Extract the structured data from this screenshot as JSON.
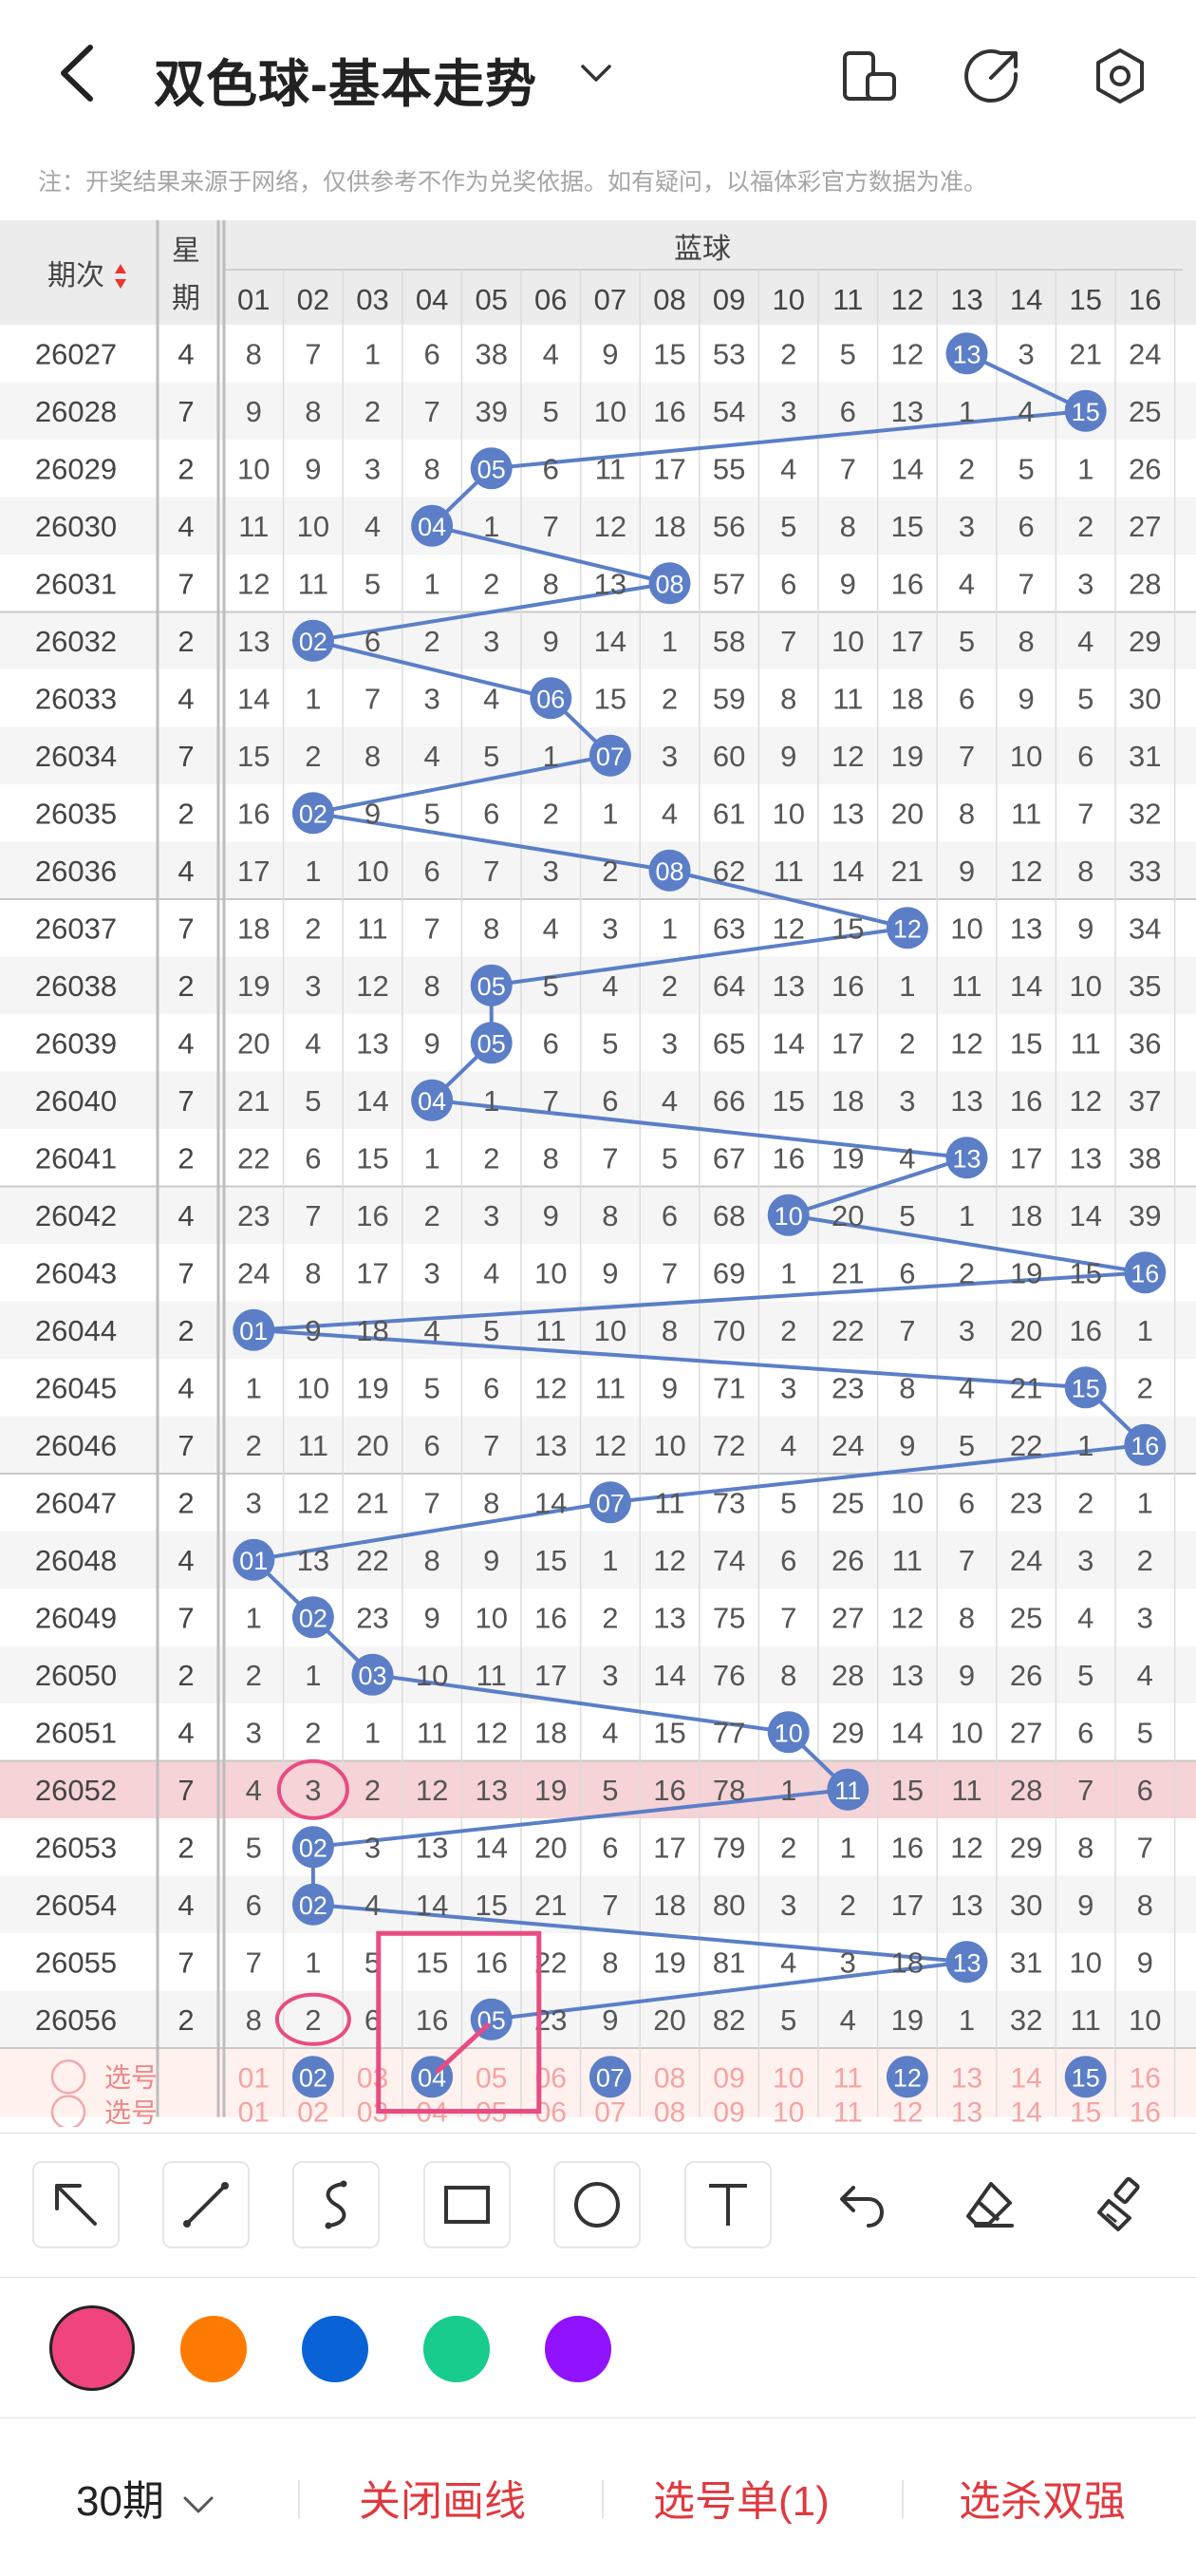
{
  "header": {
    "title": "双色球-基本走势",
    "icons": [
      "back-icon",
      "chevron-down-icon",
      "layout-icon",
      "share-icon",
      "settings-icon"
    ]
  },
  "notice": "注：开奖结果来源于网络，仅供参考不作为兑奖依据。如有疑问，以福体彩官方数据为准。",
  "table": {
    "col_period": "期次",
    "col_week_line1": "星",
    "col_week_line2": "期",
    "group_label": "蓝球",
    "col_numbers": [
      "01",
      "02",
      "03",
      "04",
      "05",
      "06",
      "07",
      "08",
      "09",
      "10",
      "11",
      "12",
      "13",
      "14",
      "15",
      "16"
    ],
    "rows": [
      {
        "period": "26027",
        "week": "4",
        "cells": [
          8,
          7,
          1,
          6,
          38,
          4,
          9,
          15,
          53,
          2,
          5,
          12,
          "13",
          3,
          21,
          24
        ]
      },
      {
        "period": "26028",
        "week": "7",
        "cells": [
          9,
          8,
          2,
          7,
          39,
          5,
          10,
          16,
          54,
          3,
          6,
          13,
          1,
          4,
          "15",
          25
        ]
      },
      {
        "period": "26029",
        "week": "2",
        "cells": [
          10,
          9,
          3,
          8,
          "05",
          6,
          11,
          17,
          55,
          4,
          7,
          14,
          2,
          5,
          1,
          26
        ]
      },
      {
        "period": "26030",
        "week": "4",
        "cells": [
          11,
          10,
          4,
          "04",
          1,
          7,
          12,
          18,
          56,
          5,
          8,
          15,
          3,
          6,
          2,
          27
        ]
      },
      {
        "period": "26031",
        "week": "7",
        "cells": [
          12,
          11,
          5,
          1,
          2,
          8,
          13,
          "08",
          57,
          6,
          9,
          16,
          4,
          7,
          3,
          28
        ]
      },
      {
        "period": "26032",
        "week": "2",
        "cells": [
          13,
          "02",
          6,
          2,
          3,
          9,
          14,
          1,
          58,
          7,
          10,
          17,
          5,
          8,
          4,
          29
        ]
      },
      {
        "period": "26033",
        "week": "4",
        "cells": [
          14,
          1,
          7,
          3,
          4,
          "06",
          15,
          2,
          59,
          8,
          11,
          18,
          6,
          9,
          5,
          30
        ]
      },
      {
        "period": "26034",
        "week": "7",
        "cells": [
          15,
          2,
          8,
          4,
          5,
          1,
          "07",
          3,
          60,
          9,
          12,
          19,
          7,
          10,
          6,
          31
        ]
      },
      {
        "period": "26035",
        "week": "2",
        "cells": [
          16,
          "02",
          9,
          5,
          6,
          2,
          1,
          4,
          61,
          10,
          13,
          20,
          8,
          11,
          7,
          32
        ]
      },
      {
        "period": "26036",
        "week": "4",
        "cells": [
          17,
          1,
          10,
          6,
          7,
          3,
          2,
          "08",
          62,
          11,
          14,
          21,
          9,
          12,
          8,
          33
        ]
      },
      {
        "period": "26037",
        "week": "7",
        "cells": [
          18,
          2,
          11,
          7,
          8,
          4,
          3,
          1,
          63,
          12,
          15,
          "12",
          10,
          13,
          9,
          34
        ]
      },
      {
        "period": "26038",
        "week": "2",
        "cells": [
          19,
          3,
          12,
          8,
          "05",
          5,
          4,
          2,
          64,
          13,
          16,
          1,
          11,
          14,
          10,
          35
        ]
      },
      {
        "period": "26039",
        "week": "4",
        "cells": [
          20,
          4,
          13,
          9,
          "05",
          6,
          5,
          3,
          65,
          14,
          17,
          2,
          12,
          15,
          11,
          36
        ]
      },
      {
        "period": "26040",
        "week": "7",
        "cells": [
          21,
          5,
          14,
          "04",
          1,
          7,
          6,
          4,
          66,
          15,
          18,
          3,
          13,
          16,
          12,
          37
        ]
      },
      {
        "period": "26041",
        "week": "2",
        "cells": [
          22,
          6,
          15,
          1,
          2,
          8,
          7,
          5,
          67,
          16,
          19,
          4,
          "13",
          17,
          13,
          38
        ]
      },
      {
        "period": "26042",
        "week": "4",
        "cells": [
          23,
          7,
          16,
          2,
          3,
          9,
          8,
          6,
          68,
          "10",
          20,
          5,
          1,
          18,
          14,
          39
        ]
      },
      {
        "period": "26043",
        "week": "7",
        "cells": [
          24,
          8,
          17,
          3,
          4,
          10,
          9,
          7,
          69,
          1,
          21,
          6,
          2,
          19,
          15,
          "16"
        ]
      },
      {
        "period": "26044",
        "week": "2",
        "cells": [
          "01",
          9,
          18,
          4,
          5,
          11,
          10,
          8,
          70,
          2,
          22,
          7,
          3,
          20,
          16,
          1
        ]
      },
      {
        "period": "26045",
        "week": "4",
        "cells": [
          1,
          10,
          19,
          5,
          6,
          12,
          11,
          9,
          71,
          3,
          23,
          8,
          4,
          21,
          "15",
          2
        ]
      },
      {
        "period": "26046",
        "week": "7",
        "cells": [
          2,
          11,
          20,
          6,
          7,
          13,
          12,
          10,
          72,
          4,
          24,
          9,
          5,
          22,
          1,
          "16"
        ]
      },
      {
        "period": "26047",
        "week": "2",
        "cells": [
          3,
          12,
          21,
          7,
          8,
          14,
          "07",
          11,
          73,
          5,
          25,
          10,
          6,
          23,
          2,
          1
        ]
      },
      {
        "period": "26048",
        "week": "4",
        "cells": [
          "01",
          13,
          22,
          8,
          9,
          15,
          1,
          12,
          74,
          6,
          26,
          11,
          7,
          24,
          3,
          2
        ]
      },
      {
        "period": "26049",
        "week": "7",
        "cells": [
          1,
          "02",
          23,
          9,
          10,
          16,
          2,
          13,
          75,
          7,
          27,
          12,
          8,
          25,
          4,
          3
        ]
      },
      {
        "period": "26050",
        "week": "2",
        "cells": [
          2,
          1,
          "03",
          10,
          11,
          17,
          3,
          14,
          76,
          8,
          28,
          13,
          9,
          26,
          5,
          4
        ]
      },
      {
        "period": "26051",
        "week": "4",
        "cells": [
          3,
          2,
          1,
          11,
          12,
          18,
          4,
          15,
          77,
          "10",
          29,
          14,
          10,
          27,
          6,
          5
        ]
      },
      {
        "period": "26052",
        "week": "7",
        "cells": [
          4,
          3,
          2,
          12,
          13,
          19,
          5,
          16,
          78,
          1,
          "11",
          15,
          11,
          28,
          7,
          6
        ]
      },
      {
        "period": "26053",
        "week": "2",
        "cells": [
          5,
          "02",
          3,
          13,
          14,
          20,
          6,
          17,
          79,
          2,
          1,
          16,
          12,
          29,
          8,
          7
        ]
      },
      {
        "period": "26054",
        "week": "4",
        "cells": [
          6,
          "02",
          4,
          14,
          15,
          21,
          7,
          18,
          80,
          3,
          2,
          17,
          13,
          30,
          9,
          8
        ]
      },
      {
        "period": "26055",
        "week": "7",
        "cells": [
          7,
          1,
          5,
          15,
          16,
          22,
          8,
          19,
          81,
          4,
          3,
          18,
          "13",
          31,
          10,
          9
        ]
      },
      {
        "period": "26056",
        "week": "2",
        "cells": [
          8,
          2,
          6,
          16,
          "05",
          23,
          9,
          20,
          82,
          5,
          4,
          19,
          1,
          32,
          11,
          10
        ]
      }
    ],
    "pick_row_label": "选号",
    "pick_row_selected": [
      "02",
      "04",
      "07",
      "12",
      "15"
    ],
    "pick_row2_label": "选号"
  },
  "toolbar": {
    "tools": [
      "arrow-tool-icon",
      "line-tool-icon",
      "curve-tool-icon",
      "rectangle-tool-icon",
      "circle-tool-icon",
      "text-tool-icon",
      "undo-icon",
      "eraser-icon",
      "clear-icon"
    ]
  },
  "colors": {
    "ball": "#5b7ec7",
    "line": "#5b7ec7",
    "highlight_row": "#f6d3d6",
    "pen": "#e84c83",
    "swatches": [
      "#f0447f",
      "#ff7a00",
      "#0a63d6",
      "#17cc8c",
      "#9012fe"
    ]
  },
  "bottom": {
    "periods": "30期",
    "close_lines": "关闭画线",
    "pick_list": "选号单(1)",
    "kill": "选杀双强"
  }
}
